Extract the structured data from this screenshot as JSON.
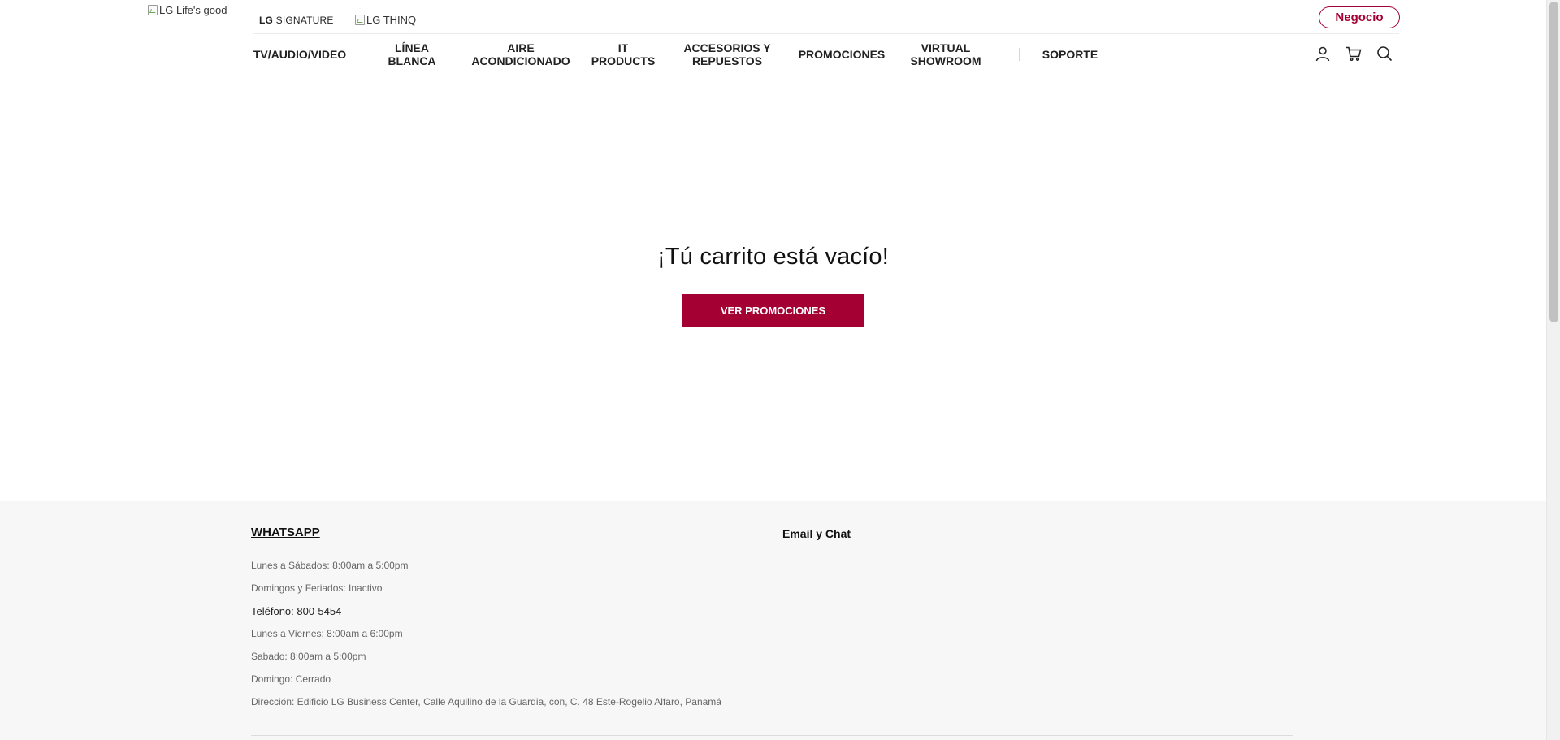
{
  "header": {
    "logo_alt": "LG Life's good",
    "signature_brand": "LG",
    "signature_suffix": "SIGNATURE",
    "thinq_alt": "LG THINQ",
    "business_button": "Negocio",
    "nav": [
      {
        "line1": "TV/AUDIO/VIDEO",
        "line2": ""
      },
      {
        "line1": "LÍNEA",
        "line2": "BLANCA"
      },
      {
        "line1": "AIRE",
        "line2": "ACONDICIONADO"
      },
      {
        "line1": "IT",
        "line2": "PRODUCTS"
      },
      {
        "line1": "ACCESORIOS Y",
        "line2": "REPUESTOS"
      },
      {
        "line1": "PROMOCIONES",
        "line2": ""
      },
      {
        "line1": "VIRTUAL",
        "line2": "SHOWROOM"
      },
      {
        "line1": "SOPORTE",
        "line2": ""
      }
    ],
    "icons": [
      "user-icon",
      "cart-icon",
      "search-icon"
    ]
  },
  "cart": {
    "empty_message": "¡Tú carrito está vacío!",
    "promo_button": "VER PROMOCIONES"
  },
  "footer": {
    "whatsapp_title": "WHATSAPP",
    "email_chat_title": "Email y Chat",
    "lines": [
      "Lunes a Sábados: 8:00am a 5:00pm",
      "Domingos y Feriados: Inactivo",
      "Teléfono: 800-5454",
      "Lunes a Viernes: 8:00am a 6:00pm",
      "Sabado: 8:00am a 5:00pm",
      "Domingo: Cerrado",
      "Dirección: Edificio LG Business Center, Calle Aquilino de la Guardia, con, C. 48 Este-Rogelio Alfaro, Panamá"
    ]
  },
  "colors": {
    "brand": "#a50034",
    "footer_bg": "#f7f7f7",
    "text": "#111111",
    "muted": "#666666"
  }
}
